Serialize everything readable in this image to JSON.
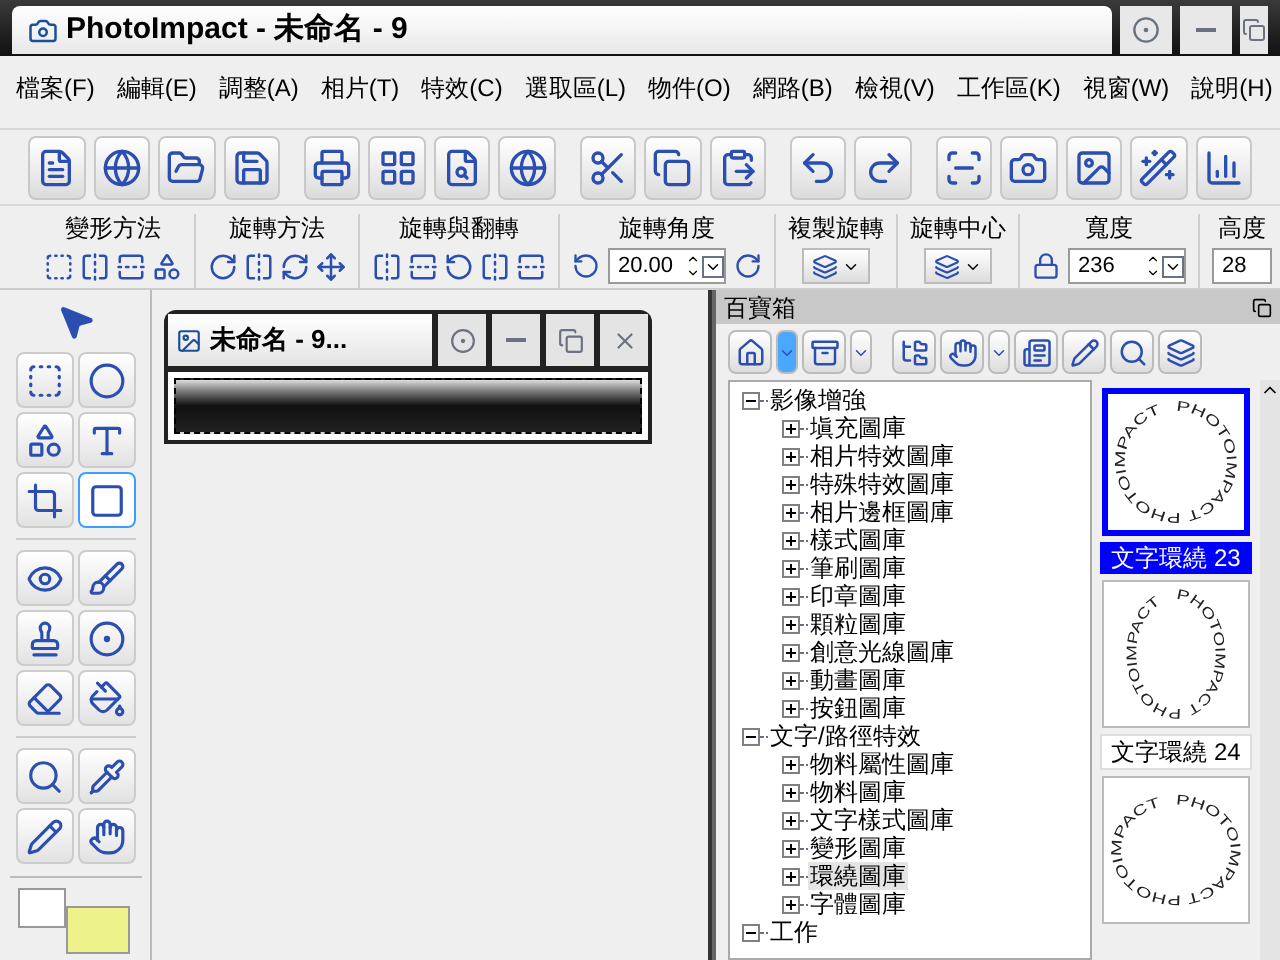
{
  "window": {
    "title": "PhotoImpact - 未命名 - 9"
  },
  "menu": [
    "檔案(F)",
    "編輯(E)",
    "調整(A)",
    "相片(T)",
    "特效(C)",
    "選取區(L)",
    "物件(O)",
    "網路(B)",
    "檢視(V)",
    "工作區(K)",
    "視窗(W)",
    "說明(H)"
  ],
  "property_bar": {
    "groups": [
      {
        "label": "變形方法",
        "kind": "icons"
      },
      {
        "label": "旋轉方法",
        "kind": "icons"
      },
      {
        "label": "旋轉與翻轉",
        "kind": "icons"
      },
      {
        "label": "旋轉角度",
        "kind": "spin",
        "value": "20.00"
      },
      {
        "label": "複製旋轉",
        "kind": "dropdown"
      },
      {
        "label": "旋轉中心",
        "kind": "dropdown"
      },
      {
        "label": "寬度",
        "kind": "spin",
        "value": "236"
      },
      {
        "label": "高度",
        "kind": "field",
        "value": "28"
      }
    ]
  },
  "document": {
    "title": "未命名 - 9..."
  },
  "easypalette": {
    "title": "百寶箱",
    "tree": [
      {
        "label": "影像增強",
        "expanded": true,
        "selected": false,
        "children": [
          {
            "label": "塡充圖庫",
            "expanded": false,
            "selected": false
          },
          {
            "label": "相片特效圖庫",
            "expanded": false,
            "selected": false
          },
          {
            "label": "特殊特效圖庫",
            "expanded": false,
            "selected": false
          },
          {
            "label": "相片邊框圖庫",
            "expanded": false,
            "selected": false
          },
          {
            "label": "樣式圖庫",
            "expanded": false,
            "selected": false
          },
          {
            "label": "筆刷圖庫",
            "expanded": false,
            "selected": false
          },
          {
            "label": "印章圖庫",
            "expanded": false,
            "selected": false
          },
          {
            "label": "顆粒圖庫",
            "expanded": false,
            "selected": false
          },
          {
            "label": "創意光線圖庫",
            "expanded": false,
            "selected": false
          },
          {
            "label": "動畫圖庫",
            "expanded": false,
            "selected": false
          },
          {
            "label": "按鈕圖庫",
            "expanded": false,
            "selected": false
          }
        ]
      },
      {
        "label": "文字/路徑特效",
        "expanded": true,
        "selected": false,
        "children": [
          {
            "label": "物料屬性圖庫",
            "expanded": false,
            "selected": false
          },
          {
            "label": "物料圖庫",
            "expanded": false,
            "selected": false
          },
          {
            "label": "文字樣式圖庫",
            "expanded": false,
            "selected": false
          },
          {
            "label": "變形圖庫",
            "expanded": false,
            "selected": false
          },
          {
            "label": "環繞圖庫",
            "expanded": false,
            "selected": true
          },
          {
            "label": "字體圖庫",
            "expanded": false,
            "selected": false
          }
        ]
      },
      {
        "label": "工作",
        "expanded": true,
        "selected": false
      }
    ],
    "thumbnails": [
      {
        "text": "PHOTOIMPACT PHOTOIMPACT",
        "label": "文字環繞 23",
        "selected": true
      },
      {
        "text": "PHOTOIMPACT PHOTOIMPACT",
        "label": "文字環繞 24",
        "selected": false
      },
      {
        "text": "PHOTOIMPACT PHOTOIMPACT",
        "selected": false
      }
    ]
  }
}
